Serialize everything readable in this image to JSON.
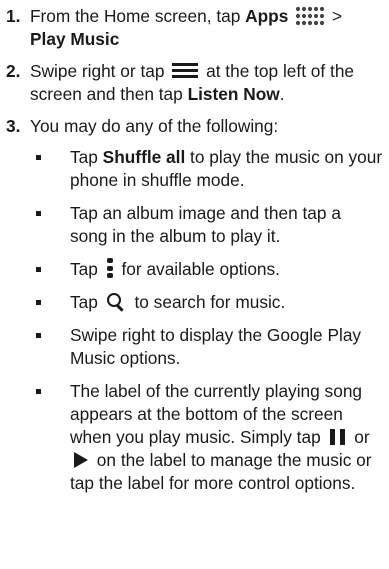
{
  "steps": [
    {
      "number": "1.",
      "text_a": "From the Home screen, tap ",
      "bold_a": "Apps",
      "text_b": " > ",
      "bold_b": "Play Music",
      "icon": "apps-grid-icon"
    },
    {
      "number": "2.",
      "text_a": "Swipe right or tap ",
      "text_b": " at the top left of the screen and then tap ",
      "bold_a": "Listen Now",
      "text_c": ".",
      "icon": "menu-icon"
    },
    {
      "number": "3.",
      "text_a": "You may do any of the following:",
      "items": [
        {
          "text_a": "Tap ",
          "bold_a": "Shuffle all",
          "text_b": " to play the music on your phone in shuffle mode."
        },
        {
          "text_a": "Tap an album image and then tap a song in the album to play it."
        },
        {
          "text_a": "Tap ",
          "text_b": " for available options.",
          "icon": "more-vertical-icon"
        },
        {
          "text_a": "Tap ",
          "text_b": " to search for music.",
          "icon": "search-icon"
        },
        {
          "text_a": "Swipe right to display the Google Play Music options."
        },
        {
          "text_a": "The label of the currently playing song appears at the bottom of the screen when you play music. Simply tap ",
          "text_b": " or ",
          "text_c": " on the label to manage the music or tap the label for more control options.",
          "icons": [
            "pause-icon",
            "play-icon"
          ]
        }
      ]
    }
  ],
  "colors": {
    "text": "#1a1a1a",
    "apps_icon": "#444444"
  }
}
